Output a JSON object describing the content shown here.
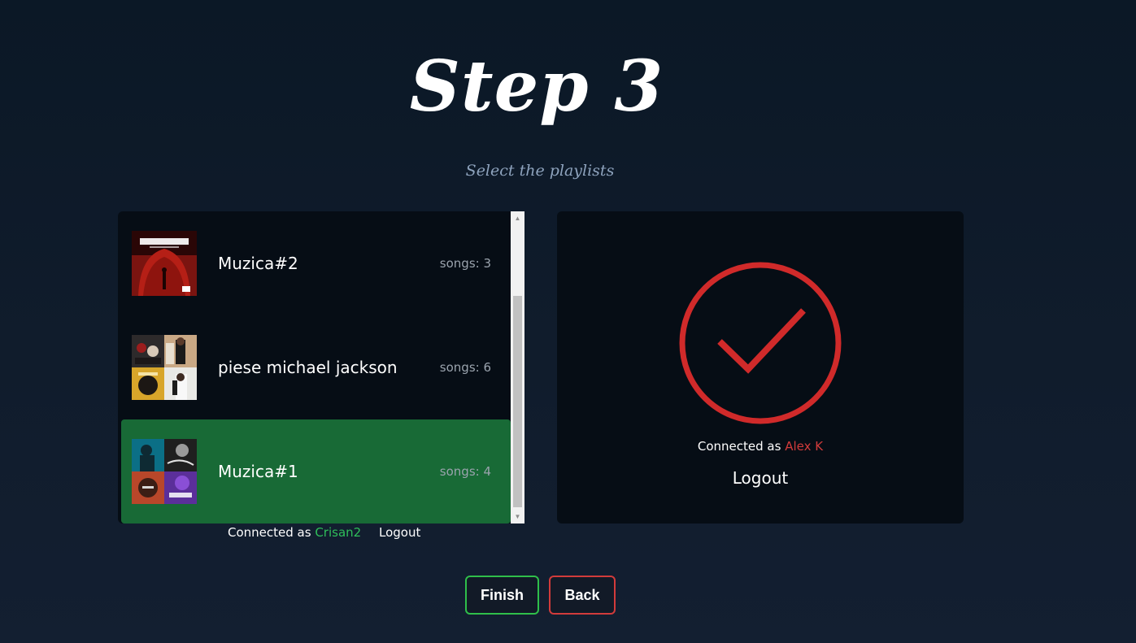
{
  "header": {
    "title": "Step 3",
    "subtitle": "Select the playlists"
  },
  "playlists": [
    {
      "name": "Muzica#2",
      "songs": "songs: 3",
      "cover": "eminem-show-album-cover",
      "selected": false
    },
    {
      "name": "piese michael jackson",
      "songs": "songs: 6",
      "cover": "michael-jackson-album-collage",
      "selected": false
    },
    {
      "name": "Muzica#1",
      "songs": "songs: 4",
      "cover": "mixed-album-collage",
      "selected": true
    }
  ],
  "left_account": {
    "prefix": "Connected as",
    "username": "Crisan2",
    "logout": "Logout"
  },
  "right_account": {
    "prefix": "Connected as",
    "username": "Alex K",
    "logout": "Logout",
    "status_icon": "check-circle-icon"
  },
  "buttons": {
    "finish": "Finish",
    "back": "Back"
  },
  "colors": {
    "selected": "#186a36",
    "green_accent": "#2fbf4a",
    "red_accent": "#d23b3b",
    "panel": "#060d15"
  }
}
